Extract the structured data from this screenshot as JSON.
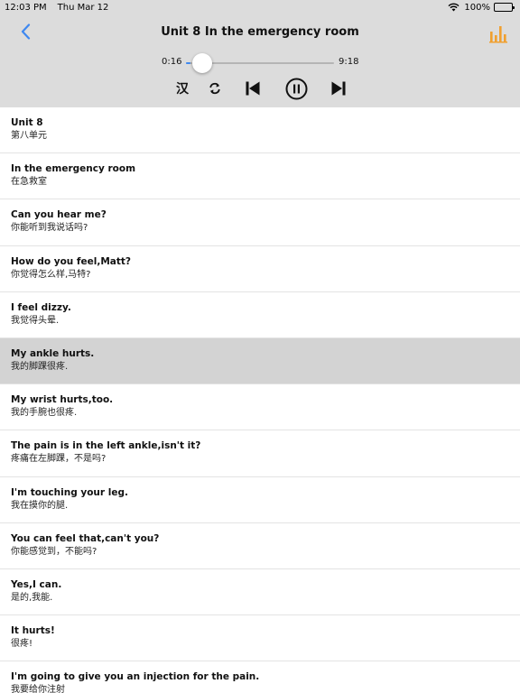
{
  "status_bar": {
    "time": "12:03 PM",
    "date": "Thu Mar 12",
    "battery": "100%"
  },
  "nav": {
    "title": "Unit 8  In the emergency room",
    "back_icon": "chevron-left-icon",
    "stats_icon": "bar-chart-icon",
    "accent_color": "#3e88f0",
    "stats_color": "#f0a030"
  },
  "player": {
    "current_time": "0:16",
    "total_time": "9:18",
    "progress_fraction": 0.03,
    "han_label": "汉",
    "icons": {
      "repeat": "repeat-icon",
      "prev": "skip-previous-icon",
      "pause": "pause-icon",
      "next": "skip-next-icon"
    }
  },
  "sentences": [
    {
      "en": "Unit 8",
      "zh": "第八单元",
      "selected": false
    },
    {
      "en": "In the emergency room",
      "zh": "在急救室",
      "selected": false
    },
    {
      "en": "Can you hear me?",
      "zh": "你能听到我说话吗?",
      "selected": false
    },
    {
      "en": "How do you feel,Matt?",
      "zh": "你觉得怎么样,马特?",
      "selected": false
    },
    {
      "en": "I feel dizzy.",
      "zh": "我觉得头晕.",
      "selected": false
    },
    {
      "en": "My ankle hurts.",
      "zh": "我的脚踝很疼.",
      "selected": true
    },
    {
      "en": "My wrist hurts,too.",
      "zh": "我的手腕也很疼.",
      "selected": false
    },
    {
      "en": "The pain is in the left ankle,isn't it?",
      "zh": "疼痛在左脚踝，不是吗?",
      "selected": false
    },
    {
      "en": "I'm touching your leg.",
      "zh": "我在摸你的腿.",
      "selected": false
    },
    {
      "en": "You can feel that,can't you?",
      "zh": "你能感觉到，不能吗?",
      "selected": false
    },
    {
      "en": "Yes,I can.",
      "zh": "是的,我能.",
      "selected": false
    },
    {
      "en": "It hurts!",
      "zh": "很疼!",
      "selected": false
    },
    {
      "en": "I'm going to give you an injection for the pain.",
      "zh": "我要给你注射",
      "selected": false
    }
  ]
}
